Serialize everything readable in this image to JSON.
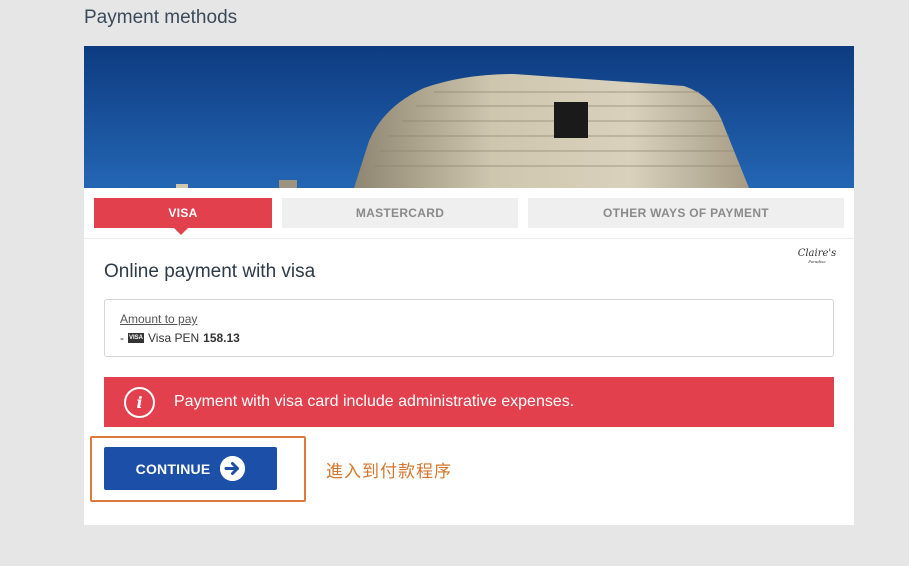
{
  "page": {
    "title": "Payment methods"
  },
  "tabs": [
    {
      "label": "VISA",
      "active": true
    },
    {
      "label": "MASTERCARD",
      "active": false
    },
    {
      "label": "OTHER WAYS OF PAYMENT",
      "active": false
    }
  ],
  "logo": {
    "line1": "Claire's",
    "line2": "Paradise"
  },
  "section": {
    "title": "Online payment with visa"
  },
  "amount": {
    "label": "Amount to pay",
    "prefix": "-",
    "card_badge": "VISA",
    "currency_text": "Visa PEN",
    "value": "158.13"
  },
  "alert": {
    "icon": "info-icon",
    "text": "Payment with visa card include administrative expenses."
  },
  "continue": {
    "label": "CONTINUE",
    "icon": "arrow-right-circle-icon"
  },
  "annotation": {
    "text": "進入到付款程序"
  },
  "colors": {
    "accent_red": "#e2404d",
    "button_blue": "#1b4fa8",
    "annotation_orange": "#e07a3a"
  }
}
